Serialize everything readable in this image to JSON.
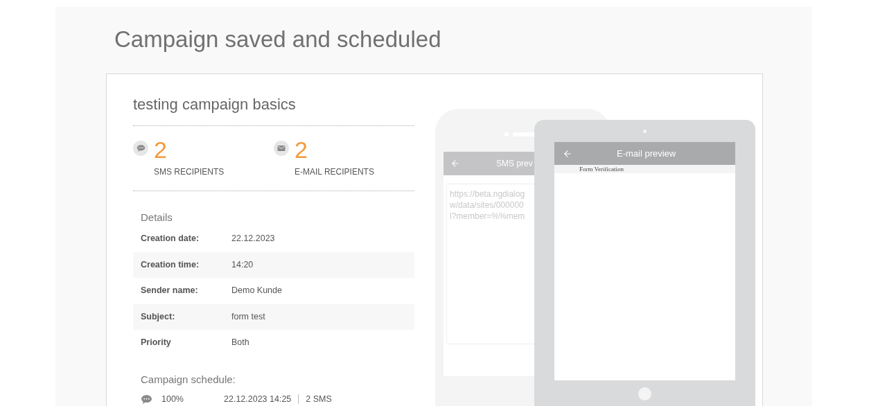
{
  "page_title": "Campaign saved and scheduled",
  "campaign": {
    "name": "testing campaign basics"
  },
  "recipients": [
    {
      "kind": "sms",
      "count": "2",
      "label": "SMS RECIPIENTS"
    },
    {
      "kind": "email",
      "count": "2",
      "label": "E-MAIL RECIPIENTS"
    }
  ],
  "details": {
    "heading": "Details",
    "rows": [
      {
        "label": "Creation date:",
        "value": "22.12.2023"
      },
      {
        "label": "Creation time:",
        "value": "14:20"
      },
      {
        "label": "Sender name:",
        "value": "Demo Kunde"
      },
      {
        "label": "Subject:",
        "value": "form test"
      },
      {
        "label": "Priority",
        "value": "Both"
      }
    ]
  },
  "schedule": {
    "heading": "Campaign schedule:",
    "items": [
      {
        "kind": "sms",
        "percent": "100%",
        "datetime": "22.12.2023 14:25",
        "amount": "2 SMS"
      }
    ]
  },
  "sms_preview": {
    "title": "SMS prev",
    "lines": [
      "https://beta.ngdialog",
      "w/data/sites/000000",
      "l?member=%%mem"
    ]
  },
  "email_preview": {
    "title": "E-mail preview",
    "subject_line": "Form Verification"
  }
}
